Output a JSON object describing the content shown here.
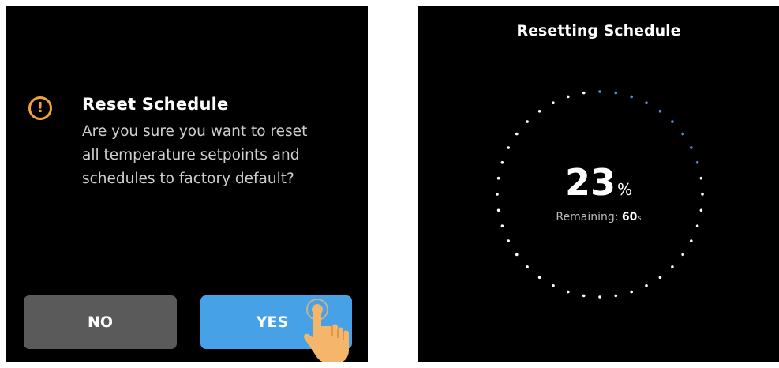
{
  "reset_dialog": {
    "title": "Reset Schedule",
    "message_lines": [
      "Are you sure you want to reset",
      "all temperature setpoints and",
      "schedules to factory default?"
    ],
    "icon": "warning-icon",
    "no_label": "NO",
    "yes_label": "YES",
    "colors": {
      "warning": "#f2a23a",
      "yes_button": "#47a1e6",
      "no_button": "#5a5a5a",
      "hand": "#f5b66c"
    }
  },
  "progress_screen": {
    "title": "Resetting Schedule",
    "percent": "23",
    "percent_unit": "%",
    "remaining_label": "Remaining: ",
    "remaining_value": "60",
    "remaining_unit": "s",
    "progress_fraction": 0.23,
    "colors": {
      "progress_dot": "#3a9be6",
      "track_dot": "#ffffff"
    }
  }
}
